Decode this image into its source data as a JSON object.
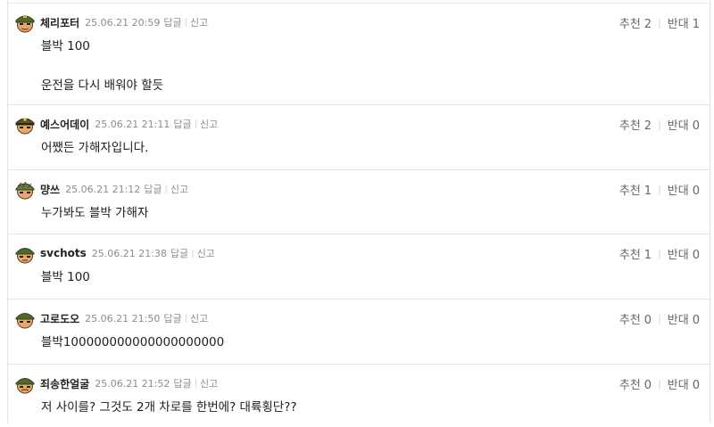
{
  "comments": [
    {
      "nickname": "체리포터",
      "timestamp": "25.06.21 20:59",
      "reply_label": "답글",
      "report_label": "신고",
      "body": [
        "블박 100",
        "운전을 다시 배워야 할듯"
      ],
      "upvote_label": "추천",
      "upvotes": "2",
      "downvote_label": "반대",
      "downvotes": "1",
      "avatar": "green-helmet-avatar-icon"
    },
    {
      "nickname": "예스어데이",
      "timestamp": "25.06.21 21:11",
      "reply_label": "답글",
      "report_label": "신고",
      "body": [
        "어쨌든 가해자입니다."
      ],
      "upvote_label": "추천",
      "upvotes": "2",
      "downvote_label": "반대",
      "downvotes": "0",
      "avatar": "officer-cap-avatar-icon"
    },
    {
      "nickname": "먕쓰",
      "timestamp": "25.06.21 21:12",
      "reply_label": "답글",
      "report_label": "신고",
      "body": [
        "누가봐도 블박 가해자"
      ],
      "upvote_label": "추천",
      "upvotes": "1",
      "downvote_label": "반대",
      "downvotes": "0",
      "avatar": "helmet-avatar-icon"
    },
    {
      "nickname": "svchots",
      "timestamp": "25.06.21 21:38",
      "reply_label": "답글",
      "report_label": "신고",
      "body": [
        "블박 100"
      ],
      "upvote_label": "추천",
      "upvotes": "1",
      "downvote_label": "반대",
      "downvotes": "0",
      "avatar": "soldier-avatar-icon"
    },
    {
      "nickname": "고로도오",
      "timestamp": "25.06.21 21:50",
      "reply_label": "답글",
      "report_label": "신고",
      "body": [
        "블박100000000000000000000"
      ],
      "upvote_label": "추천",
      "upvotes": "0",
      "downvote_label": "반대",
      "downvotes": "0",
      "avatar": "soldier-avatar-icon"
    },
    {
      "nickname": "죄송한얼굴",
      "timestamp": "25.06.21 21:52",
      "reply_label": "답글",
      "report_label": "신고",
      "body": [
        "저 사이를? 그것도 2개 차로를 한번에? 대륙횡단??"
      ],
      "upvote_label": "추천",
      "upvotes": "0",
      "downvote_label": "반대",
      "downvotes": "0",
      "avatar": "soldier-avatar-icon"
    }
  ],
  "colors": {
    "meta": "#8c8c8c",
    "divider": "#e3e3e3",
    "text": "#1d1d1d",
    "helmet": "#4f6a2c",
    "skin": "#e9a86b"
  }
}
